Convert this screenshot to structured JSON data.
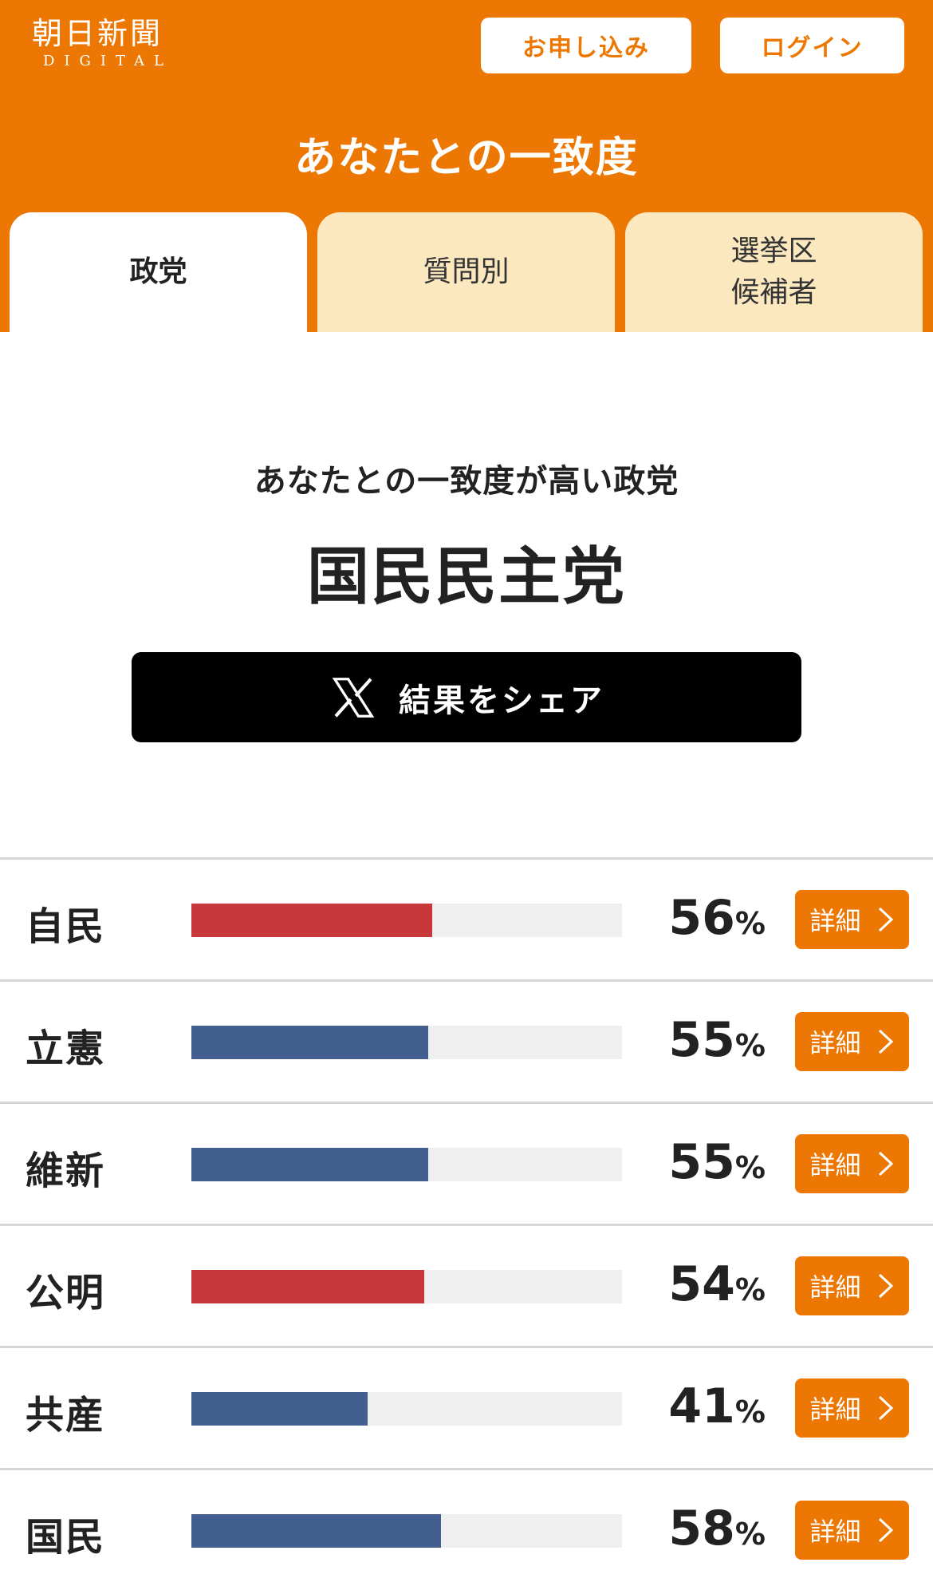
{
  "header": {
    "logo_main": "朝日新聞",
    "logo_sub": "DIGITAL",
    "apply_label": "お申し込み",
    "login_label": "ログイン",
    "title": "あなたとの一致度"
  },
  "tabs": [
    {
      "label": "政党",
      "active": true
    },
    {
      "label": "質問別",
      "active": false
    },
    {
      "label": "選挙区\n候補者",
      "active": false
    }
  ],
  "result": {
    "label": "あなたとの一致度が高い政党",
    "party": "国民民主党"
  },
  "share": {
    "label": "結果をシェア",
    "icon": "x-logo-icon"
  },
  "colors": {
    "accent": "#ed7703",
    "red_bar": "#c8373a",
    "blue_bar": "#435f90",
    "track": "#efefef"
  },
  "parties": [
    {
      "name": "自民",
      "percent": 56,
      "color": "#c8373a",
      "detail_label": "詳細"
    },
    {
      "name": "立憲",
      "percent": 55,
      "color": "#435f90",
      "detail_label": "詳細"
    },
    {
      "name": "維新",
      "percent": 55,
      "color": "#435f90",
      "detail_label": "詳細"
    },
    {
      "name": "公明",
      "percent": 54,
      "color": "#c8373a",
      "detail_label": "詳細"
    },
    {
      "name": "共産",
      "percent": 41,
      "color": "#435f90",
      "detail_label": "詳細"
    },
    {
      "name": "国民",
      "percent": 58,
      "color": "#435f90",
      "detail_label": "詳細"
    }
  ],
  "percent_unit": "%"
}
